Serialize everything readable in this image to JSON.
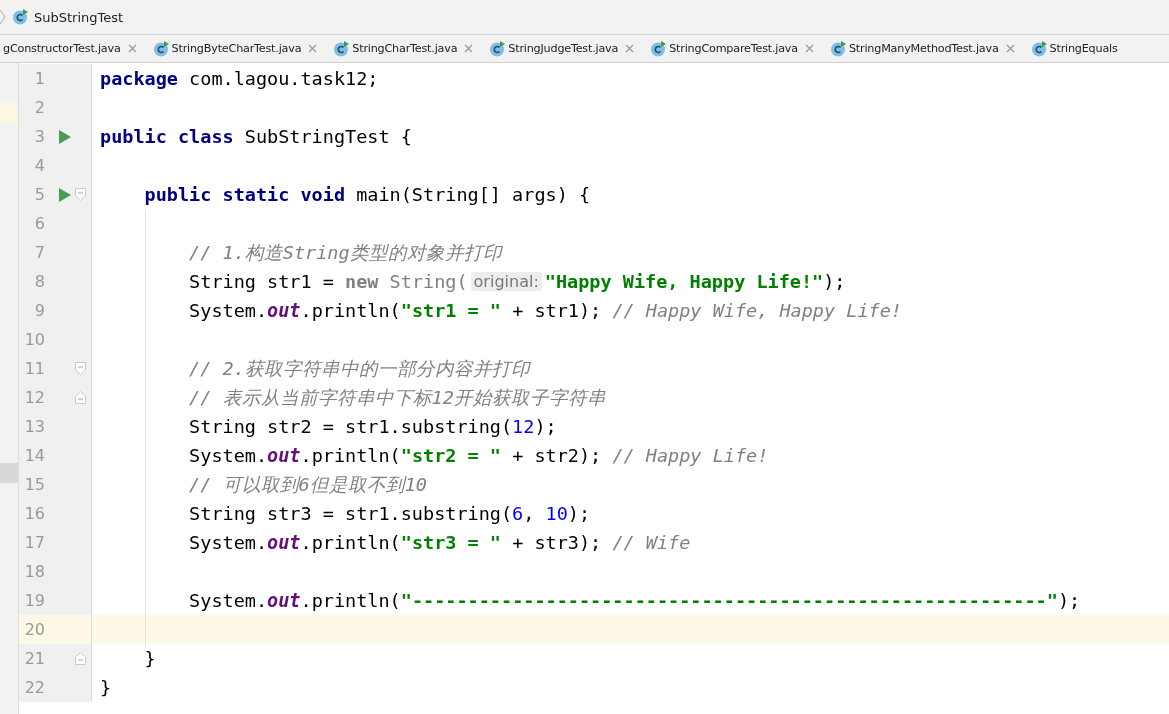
{
  "breadcrumb": {
    "label": "SubStringTest"
  },
  "tabs": [
    {
      "label": "gConstructorTest.java",
      "selected": false
    },
    {
      "label": "StringByteCharTest.java",
      "selected": false
    },
    {
      "label": "StringCharTest.java",
      "selected": false
    },
    {
      "label": "StringJudgeTest.java",
      "selected": false
    },
    {
      "label": "StringCompareTest.java",
      "selected": false
    },
    {
      "label": "StringManyMethodTest.java",
      "selected": false
    },
    {
      "label": "StringEquals",
      "selected": false
    }
  ],
  "lines": [
    {
      "number": "1",
      "kind": "line",
      "run": false,
      "current": false,
      "tokens": [
        {
          "kind": "keyword",
          "text": "package"
        },
        {
          "kind": "plain",
          "text": " com.lagou.task12;"
        }
      ]
    },
    {
      "number": "2",
      "kind": "line",
      "run": false,
      "current": false
    },
    {
      "number": "3",
      "kind": "line",
      "run": true,
      "current": false,
      "tokens": [
        {
          "kind": "keyword",
          "text": "public class"
        },
        {
          "kind": "plain",
          "text": " SubStringTest {"
        }
      ]
    },
    {
      "number": "4",
      "kind": "line",
      "run": false,
      "current": false
    },
    {
      "number": "5",
      "kind": "fold-start",
      "run": true,
      "current": false,
      "tokens": [
        {
          "kind": "keyword",
          "text": "    public static void"
        },
        {
          "kind": "plain",
          "text": " main(String[] args) {"
        }
      ]
    },
    {
      "number": "6",
      "kind": "line",
      "run": false,
      "current": false
    },
    {
      "number": "7",
      "kind": "line",
      "run": false,
      "current": false,
      "tokens": [
        {
          "kind": "comment",
          "text": "        // 1.构造String类型的对象并打印"
        }
      ]
    },
    {
      "number": "8",
      "kind": "line",
      "run": false,
      "current": false,
      "tokens": [
        {
          "kind": "plain",
          "text": "        String str1 = "
        },
        {
          "kind": "unused-keyword",
          "text": "new"
        },
        {
          "kind": "unused",
          "text": " String("
        },
        {
          "kind": "hint",
          "text": "original:"
        },
        {
          "kind": "string",
          "text": "\"Happy Wife, Happy Life!\""
        },
        {
          "kind": "plain",
          "text": ");"
        }
      ]
    },
    {
      "number": "9",
      "kind": "line",
      "run": false,
      "current": false,
      "tokens": [
        {
          "kind": "plain",
          "text": "        System."
        },
        {
          "kind": "static",
          "text": "out"
        },
        {
          "kind": "plain",
          "text": ".println("
        },
        {
          "kind": "string",
          "text": "\"str1 = \""
        },
        {
          "kind": "plain",
          "text": " + str1); "
        },
        {
          "kind": "comment",
          "text": "// Happy Wife, Happy Life!"
        }
      ]
    },
    {
      "number": "10",
      "kind": "line",
      "run": false,
      "current": false
    },
    {
      "number": "11",
      "kind": "fold-start",
      "run": false,
      "current": false,
      "tokens": [
        {
          "kind": "comment",
          "text": "        // 2.获取字符串中的一部分内容并打印"
        }
      ]
    },
    {
      "number": "12",
      "kind": "fold-end",
      "run": false,
      "current": false,
      "tokens": [
        {
          "kind": "comment",
          "text": "        // 表示从当前字符串中下标12开始获取子字符串"
        }
      ]
    },
    {
      "number": "13",
      "kind": "line",
      "run": false,
      "current": false,
      "tokens": [
        {
          "kind": "plain",
          "text": "        String str2 = str1.substring("
        },
        {
          "kind": "number",
          "text": "12"
        },
        {
          "kind": "plain",
          "text": ");"
        }
      ]
    },
    {
      "number": "14",
      "kind": "line",
      "run": false,
      "current": false,
      "tokens": [
        {
          "kind": "plain",
          "text": "        System."
        },
        {
          "kind": "static",
          "text": "out"
        },
        {
          "kind": "plain",
          "text": ".println("
        },
        {
          "kind": "string",
          "text": "\"str2 = \""
        },
        {
          "kind": "plain",
          "text": " + str2); "
        },
        {
          "kind": "comment",
          "text": "// Happy Life!"
        }
      ]
    },
    {
      "number": "15",
      "kind": "line",
      "run": false,
      "current": false,
      "tokens": [
        {
          "kind": "comment",
          "text": "        // 可以取到6但是取不到10"
        }
      ]
    },
    {
      "number": "16",
      "kind": "line",
      "run": false,
      "current": false,
      "tokens": [
        {
          "kind": "plain",
          "text": "        String str3 = str1.substring("
        },
        {
          "kind": "number",
          "text": "6"
        },
        {
          "kind": "plain",
          "text": ", "
        },
        {
          "kind": "number",
          "text": "10"
        },
        {
          "kind": "plain",
          "text": ");"
        }
      ]
    },
    {
      "number": "17",
      "kind": "line",
      "run": false,
      "current": false,
      "tokens": [
        {
          "kind": "plain",
          "text": "        System."
        },
        {
          "kind": "static",
          "text": "out"
        },
        {
          "kind": "plain",
          "text": ".println("
        },
        {
          "kind": "string",
          "text": "\"str3 = \""
        },
        {
          "kind": "plain",
          "text": " + str3); "
        },
        {
          "kind": "comment",
          "text": "// Wife"
        }
      ]
    },
    {
      "number": "18",
      "kind": "line",
      "run": false,
      "current": false
    },
    {
      "number": "19",
      "kind": "line",
      "run": false,
      "current": false,
      "tokens": [
        {
          "kind": "plain",
          "text": "        System."
        },
        {
          "kind": "static",
          "text": "out"
        },
        {
          "kind": "plain",
          "text": ".println("
        },
        {
          "kind": "string",
          "text": "\"---------------------------------------------------------\""
        },
        {
          "kind": "plain",
          "text": ");"
        }
      ]
    },
    {
      "number": "20",
      "kind": "line",
      "run": false,
      "current": true
    },
    {
      "number": "21",
      "kind": "fold-end",
      "run": false,
      "current": false,
      "tokens": [
        {
          "kind": "plain",
          "text": "    }"
        }
      ]
    },
    {
      "number": "22",
      "kind": "line",
      "run": false,
      "current": false,
      "tokens": [
        {
          "kind": "plain",
          "text": "}"
        }
      ]
    }
  ]
}
